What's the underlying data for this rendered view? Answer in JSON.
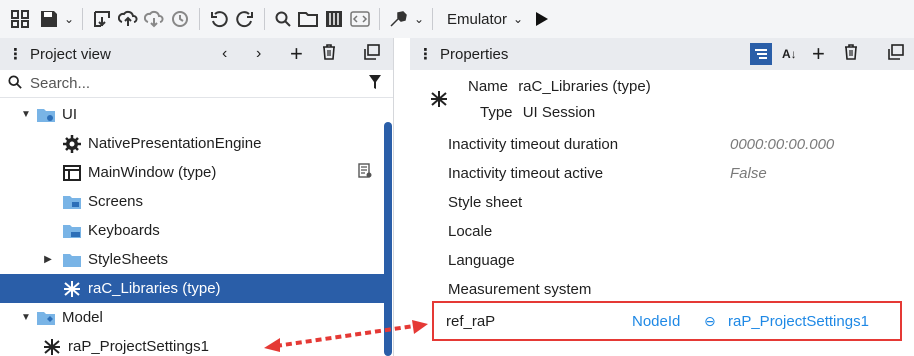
{
  "toolbar": {
    "emulator_label": "Emulator"
  },
  "project_view": {
    "title": "Project view",
    "search_placeholder": "Search...",
    "tree": [
      {
        "label": "UI",
        "level": 0,
        "expanded": true,
        "icon": "folder-ui-icon"
      },
      {
        "label": "NativePresentationEngine",
        "level": 1,
        "icon": "gear-icon"
      },
      {
        "label": "MainWindow (type)",
        "level": 1,
        "icon": "window-icon"
      },
      {
        "label": "Screens",
        "level": 1,
        "icon": "folder-screen-icon"
      },
      {
        "label": "Keyboards",
        "level": 1,
        "icon": "folder-keyboard-icon"
      },
      {
        "label": "StyleSheets",
        "level": 1,
        "collapsed": true,
        "icon": "folder-icon"
      },
      {
        "label": "raC_Libraries (type)",
        "level": 1,
        "selected": true,
        "icon": "network-icon"
      },
      {
        "label": "Model",
        "level": 0,
        "expanded": true,
        "icon": "folder-model-icon"
      },
      {
        "label": "raP_ProjectSettings1",
        "level": 1,
        "icon": "network-icon"
      }
    ]
  },
  "properties": {
    "title": "Properties",
    "name_label": "Name",
    "name_value": "raC_Libraries (type)",
    "type_label": "Type",
    "type_value": "UI Session",
    "rows": [
      {
        "label": "Inactivity timeout duration",
        "value": "0000:00:00.000"
      },
      {
        "label": "Inactivity timeout active",
        "value": "False"
      },
      {
        "label": "Style sheet",
        "value": ""
      },
      {
        "label": "Locale",
        "value": ""
      },
      {
        "label": "Language",
        "value": ""
      },
      {
        "label": "Measurement system",
        "value": ""
      }
    ],
    "ref": {
      "label": "ref_raP",
      "type": "NodeId",
      "target": "raP_ProjectSettings1"
    }
  },
  "colors": {
    "accent": "#2a5ea8",
    "highlight": "#e53935",
    "link": "#1e88e5"
  }
}
